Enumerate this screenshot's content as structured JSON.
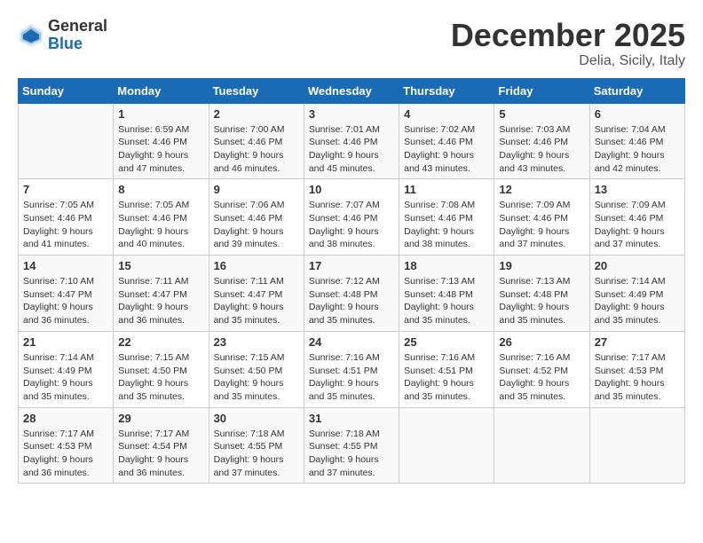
{
  "header": {
    "logo_general": "General",
    "logo_blue": "Blue",
    "month": "December 2025",
    "location": "Delia, Sicily, Italy"
  },
  "weekdays": [
    "Sunday",
    "Monday",
    "Tuesday",
    "Wednesday",
    "Thursday",
    "Friday",
    "Saturday"
  ],
  "weeks": [
    [
      {
        "day": "",
        "sunrise": "",
        "sunset": "",
        "daylight": ""
      },
      {
        "day": "1",
        "sunrise": "Sunrise: 6:59 AM",
        "sunset": "Sunset: 4:46 PM",
        "daylight": "Daylight: 9 hours and 47 minutes."
      },
      {
        "day": "2",
        "sunrise": "Sunrise: 7:00 AM",
        "sunset": "Sunset: 4:46 PM",
        "daylight": "Daylight: 9 hours and 46 minutes."
      },
      {
        "day": "3",
        "sunrise": "Sunrise: 7:01 AM",
        "sunset": "Sunset: 4:46 PM",
        "daylight": "Daylight: 9 hours and 45 minutes."
      },
      {
        "day": "4",
        "sunrise": "Sunrise: 7:02 AM",
        "sunset": "Sunset: 4:46 PM",
        "daylight": "Daylight: 9 hours and 43 minutes."
      },
      {
        "day": "5",
        "sunrise": "Sunrise: 7:03 AM",
        "sunset": "Sunset: 4:46 PM",
        "daylight": "Daylight: 9 hours and 43 minutes."
      },
      {
        "day": "6",
        "sunrise": "Sunrise: 7:04 AM",
        "sunset": "Sunset: 4:46 PM",
        "daylight": "Daylight: 9 hours and 42 minutes."
      }
    ],
    [
      {
        "day": "7",
        "sunrise": "Sunrise: 7:05 AM",
        "sunset": "Sunset: 4:46 PM",
        "daylight": "Daylight: 9 hours and 41 minutes."
      },
      {
        "day": "8",
        "sunrise": "Sunrise: 7:05 AM",
        "sunset": "Sunset: 4:46 PM",
        "daylight": "Daylight: 9 hours and 40 minutes."
      },
      {
        "day": "9",
        "sunrise": "Sunrise: 7:06 AM",
        "sunset": "Sunset: 4:46 PM",
        "daylight": "Daylight: 9 hours and 39 minutes."
      },
      {
        "day": "10",
        "sunrise": "Sunrise: 7:07 AM",
        "sunset": "Sunset: 4:46 PM",
        "daylight": "Daylight: 9 hours and 38 minutes."
      },
      {
        "day": "11",
        "sunrise": "Sunrise: 7:08 AM",
        "sunset": "Sunset: 4:46 PM",
        "daylight": "Daylight: 9 hours and 38 minutes."
      },
      {
        "day": "12",
        "sunrise": "Sunrise: 7:09 AM",
        "sunset": "Sunset: 4:46 PM",
        "daylight": "Daylight: 9 hours and 37 minutes."
      },
      {
        "day": "13",
        "sunrise": "Sunrise: 7:09 AM",
        "sunset": "Sunset: 4:46 PM",
        "daylight": "Daylight: 9 hours and 37 minutes."
      }
    ],
    [
      {
        "day": "14",
        "sunrise": "Sunrise: 7:10 AM",
        "sunset": "Sunset: 4:47 PM",
        "daylight": "Daylight: 9 hours and 36 minutes."
      },
      {
        "day": "15",
        "sunrise": "Sunrise: 7:11 AM",
        "sunset": "Sunset: 4:47 PM",
        "daylight": "Daylight: 9 hours and 36 minutes."
      },
      {
        "day": "16",
        "sunrise": "Sunrise: 7:11 AM",
        "sunset": "Sunset: 4:47 PM",
        "daylight": "Daylight: 9 hours and 35 minutes."
      },
      {
        "day": "17",
        "sunrise": "Sunrise: 7:12 AM",
        "sunset": "Sunset: 4:48 PM",
        "daylight": "Daylight: 9 hours and 35 minutes."
      },
      {
        "day": "18",
        "sunrise": "Sunrise: 7:13 AM",
        "sunset": "Sunset: 4:48 PM",
        "daylight": "Daylight: 9 hours and 35 minutes."
      },
      {
        "day": "19",
        "sunrise": "Sunrise: 7:13 AM",
        "sunset": "Sunset: 4:48 PM",
        "daylight": "Daylight: 9 hours and 35 minutes."
      },
      {
        "day": "20",
        "sunrise": "Sunrise: 7:14 AM",
        "sunset": "Sunset: 4:49 PM",
        "daylight": "Daylight: 9 hours and 35 minutes."
      }
    ],
    [
      {
        "day": "21",
        "sunrise": "Sunrise: 7:14 AM",
        "sunset": "Sunset: 4:49 PM",
        "daylight": "Daylight: 9 hours and 35 minutes."
      },
      {
        "day": "22",
        "sunrise": "Sunrise: 7:15 AM",
        "sunset": "Sunset: 4:50 PM",
        "daylight": "Daylight: 9 hours and 35 minutes."
      },
      {
        "day": "23",
        "sunrise": "Sunrise: 7:15 AM",
        "sunset": "Sunset: 4:50 PM",
        "daylight": "Daylight: 9 hours and 35 minutes."
      },
      {
        "day": "24",
        "sunrise": "Sunrise: 7:16 AM",
        "sunset": "Sunset: 4:51 PM",
        "daylight": "Daylight: 9 hours and 35 minutes."
      },
      {
        "day": "25",
        "sunrise": "Sunrise: 7:16 AM",
        "sunset": "Sunset: 4:51 PM",
        "daylight": "Daylight: 9 hours and 35 minutes."
      },
      {
        "day": "26",
        "sunrise": "Sunrise: 7:16 AM",
        "sunset": "Sunset: 4:52 PM",
        "daylight": "Daylight: 9 hours and 35 minutes."
      },
      {
        "day": "27",
        "sunrise": "Sunrise: 7:17 AM",
        "sunset": "Sunset: 4:53 PM",
        "daylight": "Daylight: 9 hours and 35 minutes."
      }
    ],
    [
      {
        "day": "28",
        "sunrise": "Sunrise: 7:17 AM",
        "sunset": "Sunset: 4:53 PM",
        "daylight": "Daylight: 9 hours and 36 minutes."
      },
      {
        "day": "29",
        "sunrise": "Sunrise: 7:17 AM",
        "sunset": "Sunset: 4:54 PM",
        "daylight": "Daylight: 9 hours and 36 minutes."
      },
      {
        "day": "30",
        "sunrise": "Sunrise: 7:18 AM",
        "sunset": "Sunset: 4:55 PM",
        "daylight": "Daylight: 9 hours and 37 minutes."
      },
      {
        "day": "31",
        "sunrise": "Sunrise: 7:18 AM",
        "sunset": "Sunset: 4:55 PM",
        "daylight": "Daylight: 9 hours and 37 minutes."
      },
      {
        "day": "",
        "sunrise": "",
        "sunset": "",
        "daylight": ""
      },
      {
        "day": "",
        "sunrise": "",
        "sunset": "",
        "daylight": ""
      },
      {
        "day": "",
        "sunrise": "",
        "sunset": "",
        "daylight": ""
      }
    ]
  ]
}
